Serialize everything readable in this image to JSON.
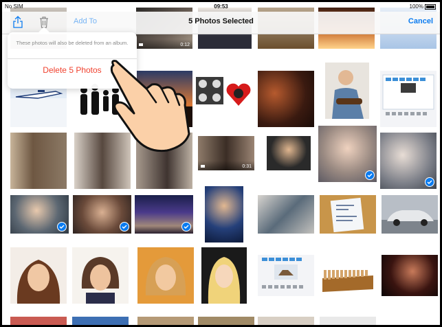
{
  "status_bar": {
    "carrier": "No SIM",
    "time": "09:53",
    "battery": "100%"
  },
  "nav": {
    "title": "5 Photos Selected",
    "cancel_label": "Cancel",
    "add_to_label": "Add To",
    "share_icon": "share-icon",
    "trash_icon": "trash-icon"
  },
  "popover": {
    "message": "These photos will also be deleted from an album.",
    "delete_label": "Delete 5 Photos"
  },
  "video_durations": {
    "r0c1": "0:12",
    "r2c3": "0:31"
  },
  "colors": {
    "accent": "#0a7bf0",
    "destructive": "#f0412e"
  }
}
